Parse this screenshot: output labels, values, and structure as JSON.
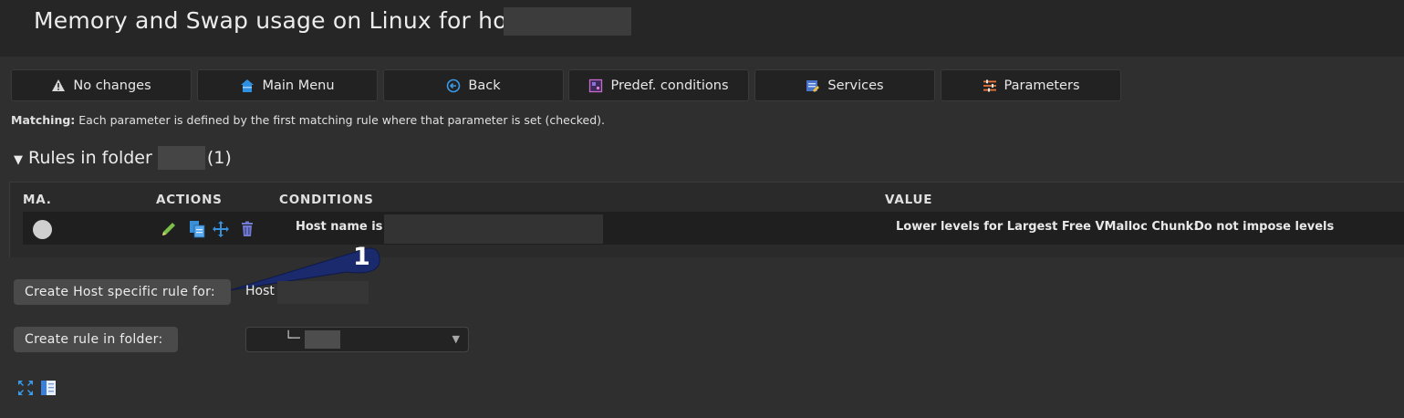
{
  "header": {
    "title": "Memory and Swap usage on Linux for host"
  },
  "toolbar": {
    "buttons": [
      {
        "label": "No changes",
        "icon": "warning-icon"
      },
      {
        "label": "Main Menu",
        "icon": "home-icon"
      },
      {
        "label": "Back",
        "icon": "back-icon"
      },
      {
        "label": "Predef. conditions",
        "icon": "predefined-conditions-icon"
      },
      {
        "label": "Services",
        "icon": "services-icon"
      },
      {
        "label": "Parameters",
        "icon": "parameters-icon"
      }
    ]
  },
  "matching": {
    "label": "Matching:",
    "text": "Each parameter is defined by the first matching rule where that parameter is set (checked)."
  },
  "folder_section": {
    "prefix": "Rules in folder",
    "count": "(1)"
  },
  "rules_table": {
    "headers": [
      "MA.",
      "ACTIONS",
      "CONDITIONS",
      "VALUE"
    ],
    "rows": [
      {
        "condition": "Host name is",
        "value_label": "Lower levels for Largest Free VMalloc Chunk:",
        "value": "Do not impose levels"
      }
    ]
  },
  "callout": {
    "number": "1"
  },
  "create_host_rule": {
    "button_label": "Create Host specific rule for:",
    "host_label": "Host"
  },
  "create_folder_rule": {
    "button_label": "Create rule in folder:",
    "selected_prefix": "└─"
  },
  "colors": {
    "background": "#2f2f2f",
    "header_bg": "#262626",
    "button_bg": "#222222",
    "accent_green": "#7cc04a",
    "accent_blue": "#3a8fd9",
    "callout_fill": "#1a2a6c"
  }
}
